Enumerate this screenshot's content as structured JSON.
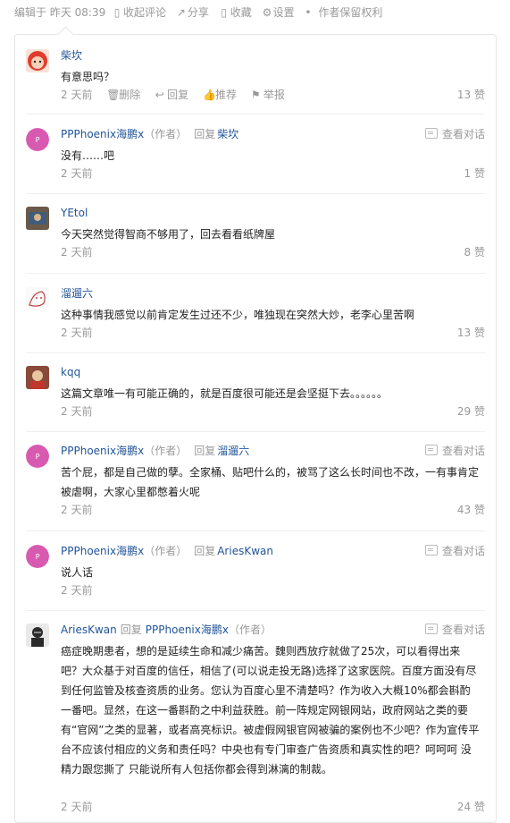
{
  "meta_bar": {
    "edited": "编辑于 昨天 08:39",
    "collapse_comments": "收起评论",
    "share": "分享",
    "favorite": "收藏",
    "settings": "设置",
    "separator": "•",
    "copyright": "作者保留权利"
  },
  "comments": [
    {
      "author": "柴坎",
      "text": "有意思吗？",
      "time": "2 天前",
      "likes": "13 赞",
      "actions": {
        "delete": "删除",
        "reply": "回复",
        "like": "推荐",
        "report": "举报"
      }
    },
    {
      "author": "PPPhoenix海鹏x",
      "author_tag": "（作者）",
      "reply_word": "回复",
      "reply_to": "柴坎",
      "view_conversation": "查看对话",
      "text": "没有……吧",
      "time": "2 天前",
      "likes": "1 赞"
    },
    {
      "author": "YEtol",
      "text": "今天突然觉得智商不够用了，回去看看纸牌屋",
      "time": "2 天前",
      "likes": "8 赞"
    },
    {
      "author": "溜遛六",
      "text": "这种事情我感觉以前肯定发生过还不少，唯独现在突然大炒，老李心里苦啊",
      "time": "2 天前",
      "likes": "13 赞"
    },
    {
      "author": "kqq",
      "text": "这篇文章唯一有可能正确的，就是百度很可能还是会坚挺下去。。。。。。",
      "time": "2 天前",
      "likes": "29 赞"
    },
    {
      "author": "PPPhoenix海鹏x",
      "author_tag": "（作者）",
      "reply_word": "回复",
      "reply_to": "溜遛六",
      "view_conversation": "查看对话",
      "text": "苦个屁，都是自己做的孽。全家桶、贴吧什么的，被骂了这么长时间也不改，一有事肯定被虐啊，大家心里都憋着火呢",
      "time": "2 天前",
      "likes": "43 赞"
    },
    {
      "author": "PPPhoenix海鹏x",
      "author_tag": "（作者）",
      "reply_word": "回复",
      "reply_to": "AriesKwan",
      "view_conversation": "查看对话",
      "text": "说人话",
      "time": "2 天前",
      "likes": ""
    },
    {
      "author": "AriesKwan",
      "reply_word": "回复",
      "reply_to": "PPPhoenix海鹏x",
      "reply_to_tag": "（作者）",
      "view_conversation": "查看对话",
      "text": "癌症晚期患者，想的是延续生命和减少痛苦。魏则西放疗就做了25次，可以看得出来吧？大众基于对百度的信任，相信了(可以说走投无路)选择了这家医院。百度方面没有尽到任何监管及核查资质的业务。您认为百度心里不清楚吗？作为收入大概10%都会斟酌一番吧。显然，在这一番斟酌之中利益获胜。前一阵规定网银网站，政府网站之类的要有“官网”之类的显著，或者高亮标识。被虚假网银官网被骗的案例也不少吧？作为宣传平台不应该付相应的义务和责任吗？中央也有专门审查广告资质和真实性的吧？呵呵呵 没精力跟您撕了 只能说所有人包括你都会得到淋漓的制裁。",
      "time": "2 天前",
      "likes": "24 赞"
    }
  ]
}
